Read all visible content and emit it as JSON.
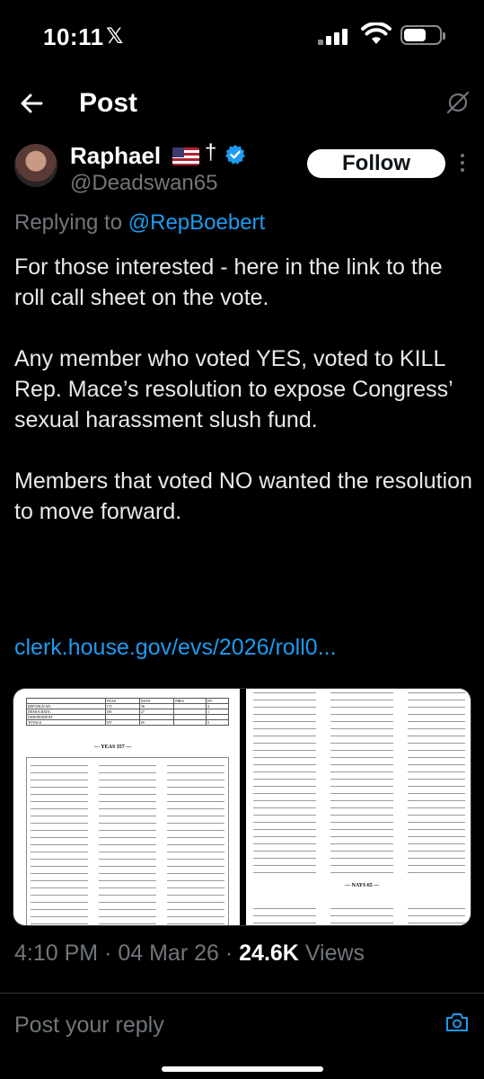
{
  "status_bar": {
    "time": "10:11",
    "app_glyph": "𝕏",
    "icons": [
      "signal-icon",
      "wifi-icon",
      "battery-icon"
    ]
  },
  "header": {
    "title": "Post",
    "back_icon": "arrow-left-icon",
    "share_icon": "grok-icon"
  },
  "author": {
    "name": "Raphael",
    "emoji_flag": "🇺🇸",
    "cross": "†",
    "handle": "@Deadswan65",
    "verified": true,
    "follow_label": "Follow"
  },
  "reply": {
    "prefix": "Replying to",
    "mention": "@RepBoebert"
  },
  "tweet": {
    "paragraphs": [
      "For those interested - here in the link to the roll call sheet on the vote.",
      "Any member who voted YES, voted to KILL Rep. Mace’s resolution to expose Congress’ sexual harassment slush fund.",
      "Members that voted NO wanted the resolution to move forward."
    ],
    "link": "clerk.house.gov/evs/2026/roll0..."
  },
  "media": {
    "yeas_heading": "— YEAS 357 —",
    "nays_heading": "— NAYS 65 —",
    "summary_headers": [
      "",
      "YEAS",
      "NAYS",
      "PRES",
      "NV"
    ],
    "summary_rows": [
      [
        "REPUBLICAN",
        "172",
        "38",
        "",
        "4"
      ],
      [
        "DEMOCRATIC",
        "185",
        "27",
        "",
        "1"
      ],
      [
        "INDEPENDENT",
        "",
        "",
        "",
        ""
      ],
      [
        "TOTALS",
        "357",
        "65",
        "",
        "5"
      ]
    ]
  },
  "meta": {
    "time": "4:10 PM",
    "date": "04 Mar 26",
    "views": "24.6K",
    "views_label": "Views"
  },
  "composer": {
    "placeholder": "Post your reply"
  },
  "colors": {
    "background": "#000000",
    "link": "#1d9bf0",
    "secondary": "#71767b",
    "verified": "#1d9bf0"
  }
}
